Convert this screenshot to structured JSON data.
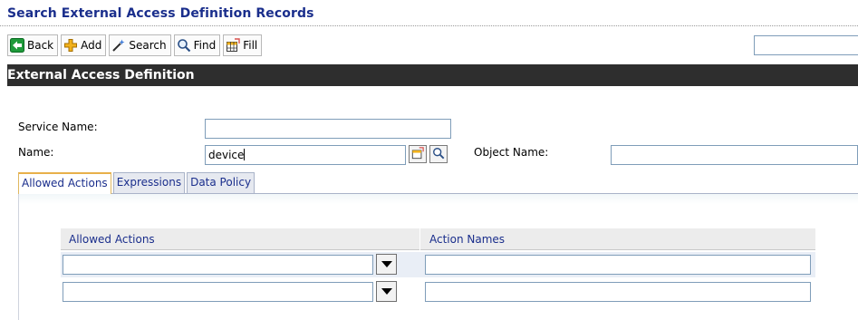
{
  "page": {
    "title": "Search External Access Definition Records"
  },
  "toolbar": {
    "back_label": "Back",
    "add_label": "Add",
    "search_label": "Search",
    "find_label": "Find",
    "fill_label": "Fill",
    "quick_search_value": ""
  },
  "section": {
    "title": "External Access Definition"
  },
  "form": {
    "service_name_label": "Service Name:",
    "service_name_value": "",
    "name_label": "Name:",
    "name_value": "device",
    "object_name_label": "Object Name:",
    "object_name_value": ""
  },
  "tabs": [
    {
      "label": "Allowed Actions",
      "active": true
    },
    {
      "label": "Expressions",
      "active": false
    },
    {
      "label": "Data Policy",
      "active": false
    }
  ],
  "grid": {
    "columns": [
      "Allowed Actions",
      "Action Names"
    ],
    "rows": [
      {
        "allowed_action": "",
        "action_name": ""
      },
      {
        "allowed_action": "",
        "action_name": ""
      }
    ]
  },
  "colors": {
    "title_blue": "#1a2e8c",
    "section_bar": "#2e2e2e",
    "active_tab_accent": "#e8b04a",
    "field_border": "#7f9db9"
  },
  "icons": {
    "back": "arrow-left-icon",
    "add": "plus-icon",
    "search": "wand-icon",
    "find": "magnifier-icon",
    "fill": "table-fill-icon"
  }
}
